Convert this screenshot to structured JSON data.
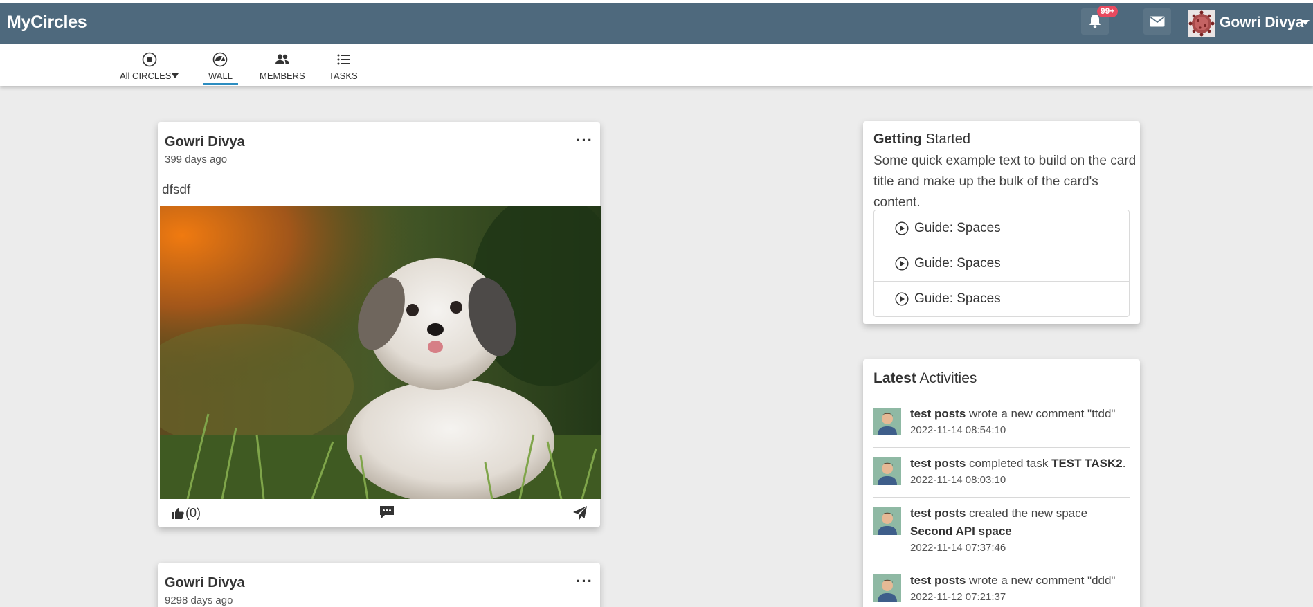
{
  "app": {
    "title": "MyCircles"
  },
  "header": {
    "notification_count": "99+",
    "user_name": "Gowri Divya",
    "icons": [
      "bell-icon",
      "envelope-icon",
      "caret-down-icon"
    ]
  },
  "subnav": {
    "items": [
      {
        "label": "All CIRCLES",
        "icon": "circle-dot-icon"
      },
      {
        "label": "WALL",
        "icon": "gauge-icon"
      },
      {
        "label": "MEMBERS",
        "icon": "users-icon"
      },
      {
        "label": "TASKS",
        "icon": "list-icon"
      }
    ],
    "active": "WALL"
  },
  "posts": [
    {
      "author": "Gowri Divya",
      "time": "399 days ago",
      "text": "dfsdf",
      "likes": "(0)",
      "image": "dog-photo"
    },
    {
      "author": "Gowri Divya",
      "time": "9298 days ago"
    }
  ],
  "getting_started": {
    "title_bold": "Getting",
    "title_rest": " Started",
    "text": "Some quick example text to build on the card title and make up the bulk of the card's content.",
    "guides": [
      "Guide: Spaces",
      "Guide: Spaces",
      "Guide: Spaces"
    ]
  },
  "latest_activities": {
    "title_bold": "Latest",
    "title_rest": " Activities",
    "items": [
      {
        "user": "test posts",
        "action": " wrote a new comment \"ttdd\"",
        "target": "",
        "suffix": "",
        "time": "2022-11-14 08:54:10"
      },
      {
        "user": "test posts",
        "action": " completed task ",
        "target": "TEST TASK2",
        "suffix": ".",
        "time": "2022-11-14 08:03:10"
      },
      {
        "user": "test posts",
        "action": " created the new space ",
        "target": "Second API space",
        "suffix": "",
        "time": "2022-11-14 07:37:46"
      },
      {
        "user": "test posts",
        "action": " wrote a new comment \"ddd\"",
        "target": "",
        "suffix": "",
        "time": "2022-11-12 07:21:37"
      }
    ]
  },
  "colors": {
    "header_bg": "#4e697d",
    "accent": "#2c8dc1",
    "badge": "#e84a5f",
    "page_bg": "#ececec"
  }
}
